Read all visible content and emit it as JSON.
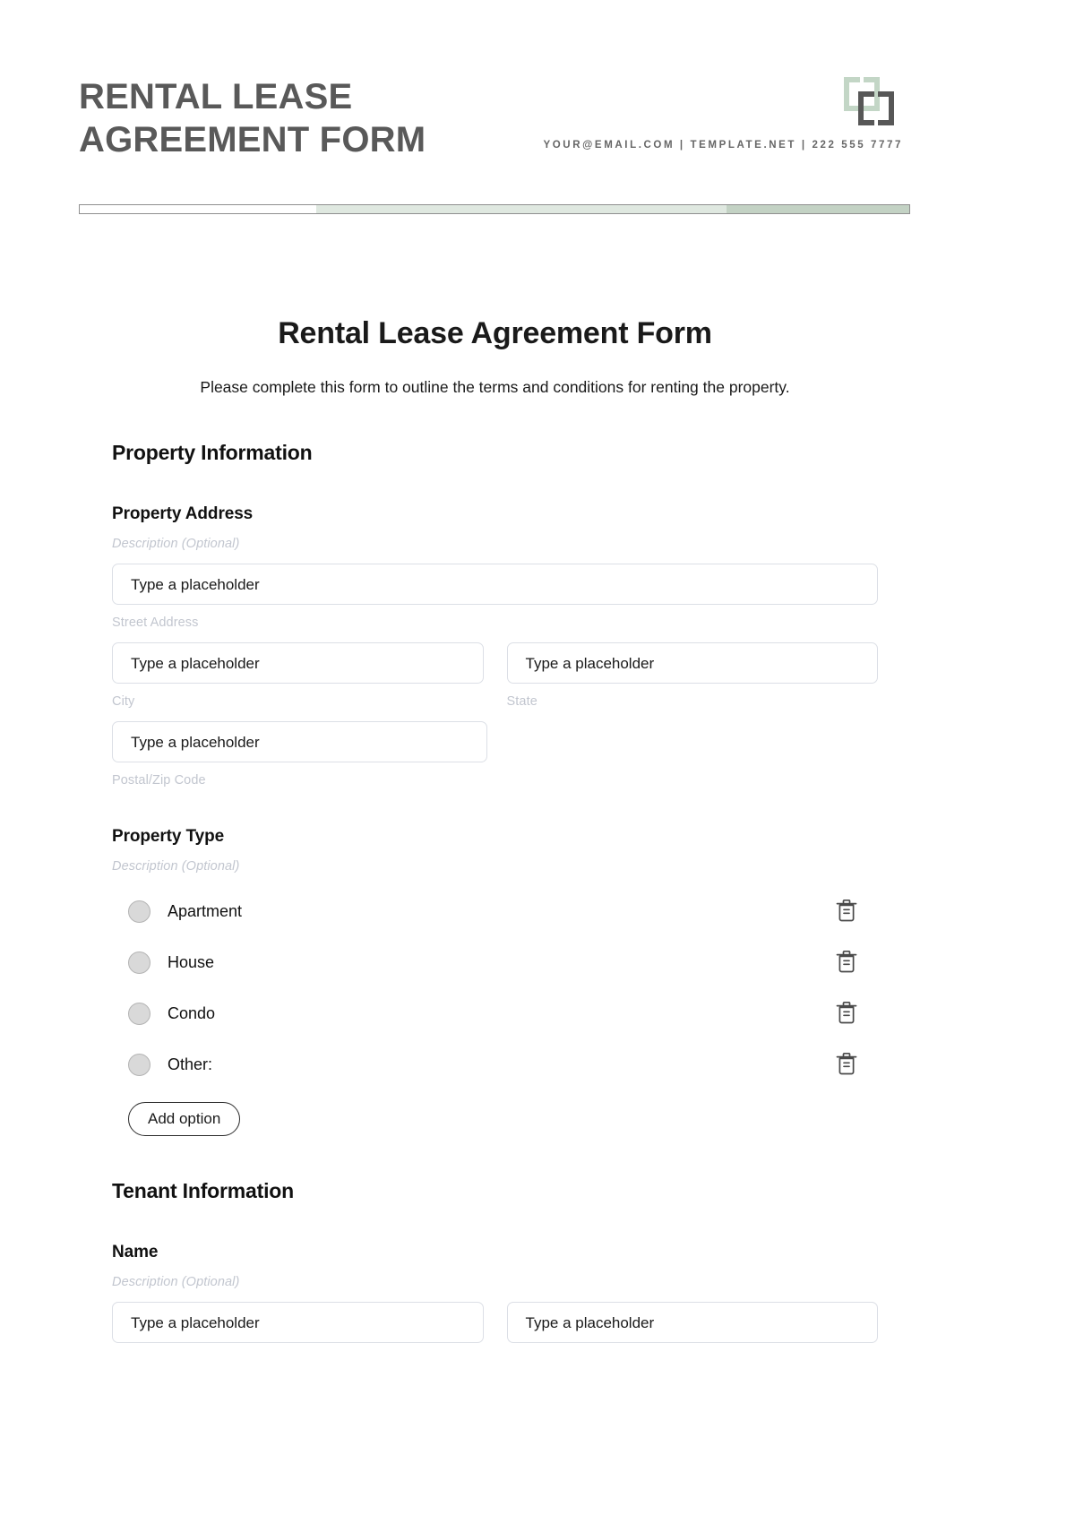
{
  "letterhead": {
    "title": "RENTAL LEASE AGREEMENT FORM",
    "contact": "YOUR@EMAIL.COM | TEMPLATE.NET | 222 555 7777",
    "logo_icon": "bracket-logo-icon",
    "bar_colors": [
      "#ffffff",
      "#dfe8e0",
      "#c3d2c4"
    ]
  },
  "form": {
    "title": "Rental Lease Agreement Form",
    "subtitle": "Please complete this form to outline the terms and conditions for renting the property.",
    "description_placeholder": "Description (Optional)",
    "input_placeholder": "Type a placeholder",
    "sections": [
      {
        "heading": "Property Information",
        "fields": [
          {
            "label": "Property Address",
            "description": "Description (Optional)",
            "rows": [
              [
                {
                  "value": "Type a placeholder",
                  "sub_label": "Street Address"
                }
              ],
              [
                {
                  "value": "Type a placeholder",
                  "sub_label": "City"
                },
                {
                  "value": "Type a placeholder",
                  "sub_label": "State"
                }
              ],
              [
                {
                  "value": "Type a placeholder",
                  "sub_label": "Postal/Zip Code"
                }
              ]
            ]
          },
          {
            "label": "Property Type",
            "description": "Description (Optional)",
            "options": [
              {
                "label": "Apartment",
                "delete_icon": "trash-icon"
              },
              {
                "label": "House",
                "delete_icon": "trash-icon"
              },
              {
                "label": "Condo",
                "delete_icon": "trash-icon"
              },
              {
                "label": "Other:",
                "delete_icon": "trash-icon"
              }
            ],
            "add_option_label": "Add option"
          }
        ]
      },
      {
        "heading": "Tenant Information",
        "fields": [
          {
            "label": "Name",
            "description": "Description (Optional)",
            "rows": [
              [
                {
                  "value": "Type a placeholder",
                  "sub_label": ""
                },
                {
                  "value": "Type a placeholder",
                  "sub_label": ""
                }
              ]
            ]
          }
        ]
      }
    ]
  }
}
